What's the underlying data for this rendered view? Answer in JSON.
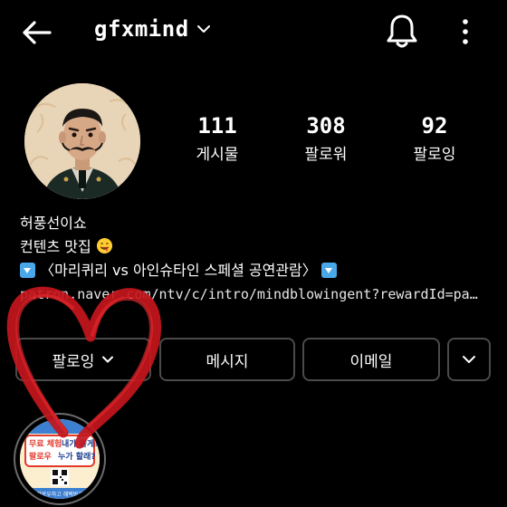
{
  "header": {
    "username": "gfxmind"
  },
  "stats": {
    "posts": {
      "count": "111",
      "label": "게시물"
    },
    "followers": {
      "count": "308",
      "label": "팔로워"
    },
    "following": {
      "count": "92",
      "label": "팔로잉"
    }
  },
  "bio": {
    "name": "허풍선이쇼",
    "line2": "컨텐츠 맛집",
    "line3": "〈마리퀴리 vs 아인슈타인 스페셜 공연관람〉",
    "link": "patron.naver.com/ntv/c/intro/mindblowingent?rewardId=pat…"
  },
  "buttons": {
    "following": "팔로잉",
    "message": "메시지",
    "email": "이메일"
  },
  "highlight": {
    "line1": "무료 체험",
    "line2": "내가 쏠게!",
    "line3": "팔로우",
    "line4": "누가 할래?",
    "bottom": "팔로우하고 혜택받기"
  },
  "colors": {
    "background": "#000000",
    "heart": "#c4161c",
    "button_border": "#4a4a4a",
    "emoji_box": "#4aa8e8"
  },
  "icons": [
    "back-arrow-icon",
    "chevron-down-icon",
    "bell-icon",
    "more-vertical-icon",
    "smiling-face-emoji",
    "down-arrow-box-emoji",
    "qr-code-icon"
  ]
}
